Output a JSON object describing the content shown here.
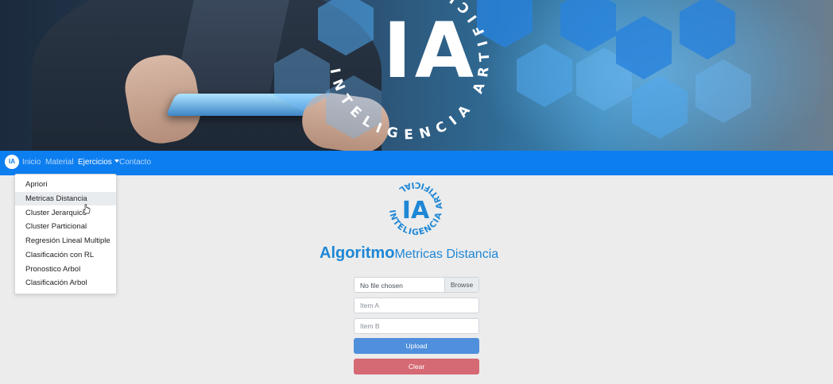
{
  "banner": {
    "ia_text": "IA",
    "ring_text": "INTELIGENCIA ARTIFICIAL"
  },
  "navbar": {
    "logo_text": "IA",
    "links": [
      {
        "label": "Inicio"
      },
      {
        "label": "Material"
      },
      {
        "label": "Ejercicios"
      },
      {
        "label": "Contacto"
      }
    ]
  },
  "dropdown": {
    "items": [
      {
        "label": "Apriori"
      },
      {
        "label": "Metricas Distancia"
      },
      {
        "label": "Cluster Jerarquico"
      },
      {
        "label": "Cluster Particional"
      },
      {
        "label": "Regresión Lineal Multiple"
      },
      {
        "label": "Clasificación con RL"
      },
      {
        "label": "Pronostico Arbol"
      },
      {
        "label": "Clasificación Arbol"
      }
    ],
    "hovered_item": "Metricas Distancia"
  },
  "logo": {
    "center_text": "IA",
    "ring_text": "INTELIGENCIA ARTIFICIAL"
  },
  "page": {
    "title_bold": "Algoritmo",
    "title_rest": "Metricas Distancia"
  },
  "form": {
    "file_text": "No file chosen",
    "browse_label": "Browse",
    "item_a_placeholder": "Item A",
    "item_b_placeholder": "Item B",
    "upload_label": "Upload",
    "clear_label": "Clear"
  },
  "colors": {
    "navbar": "#0d7ef0",
    "title": "#1e87d6",
    "upload_button": "#4f8fdc",
    "clear_button": "#d56a74"
  }
}
